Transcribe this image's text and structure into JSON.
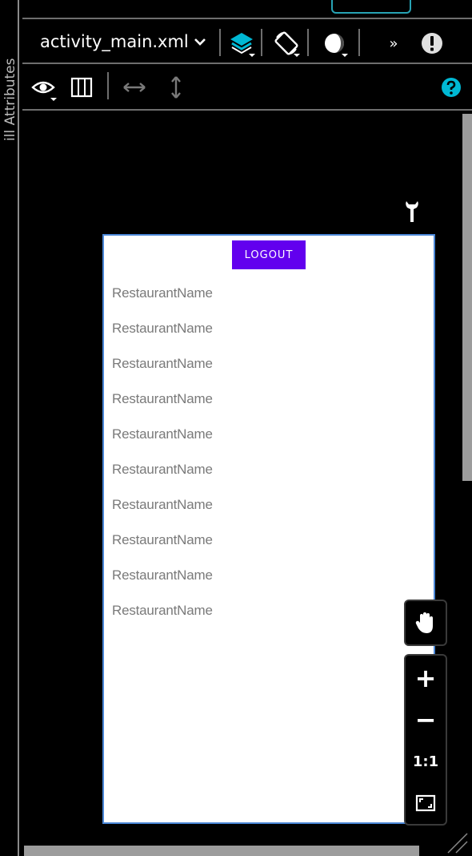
{
  "side_panel": {
    "label": "Attributes",
    "partial_prefix": "ill"
  },
  "toolbar": {
    "file_name": "activity_main.xml",
    "overflow_label": "»"
  },
  "preview": {
    "logout_label": "LOGOUT",
    "items": [
      "RestaurantName",
      "RestaurantName",
      "RestaurantName",
      "RestaurantName",
      "RestaurantName",
      "RestaurantName",
      "RestaurantName",
      "RestaurantName",
      "RestaurantName",
      "RestaurantName"
    ]
  },
  "zoom_controls": {
    "zoom_in_label": "+",
    "zoom_out_label": "−",
    "actual_size_label": "1:1"
  },
  "colors": {
    "accent_cyan": "#00b8d4",
    "button_purple": "#6200ee",
    "device_border": "#4a86d6",
    "help_cyan": "#00b8d4"
  }
}
